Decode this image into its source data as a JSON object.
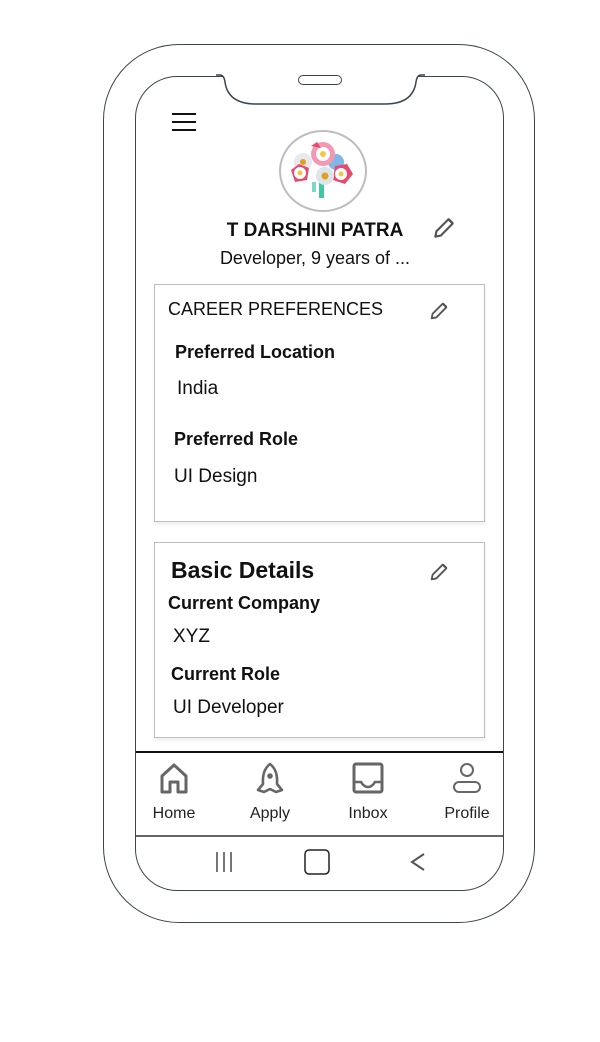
{
  "header": {
    "menu_icon": "hamburger-menu-icon",
    "avatar_icon": "flower-bouquet-avatar",
    "name": "T DARSHINI PATRA",
    "subtitle": "Developer, 9 years of ...",
    "edit_icon": "pencil-icon"
  },
  "career_preferences": {
    "title": "CAREER PREFERENCES",
    "fields": [
      {
        "label": "Preferred Location",
        "value": "India"
      },
      {
        "label": "Preferred Role",
        "value": "UI Design"
      }
    ]
  },
  "basic_details": {
    "title": "Basic Details",
    "fields": [
      {
        "label": "Current Company",
        "value": "XYZ"
      },
      {
        "label": "Current Role",
        "value": "UI Developer"
      }
    ]
  },
  "bottom_nav": {
    "items": [
      {
        "label": "Home",
        "icon": "home-icon"
      },
      {
        "label": "Apply",
        "icon": "rocket-icon"
      },
      {
        "label": "Inbox",
        "icon": "inbox-icon"
      },
      {
        "label": "Profile",
        "icon": "user-icon"
      }
    ]
  },
  "system_nav": {
    "recents": "recent-apps-icon",
    "home": "home-square-icon",
    "back": "back-chevron-icon"
  }
}
